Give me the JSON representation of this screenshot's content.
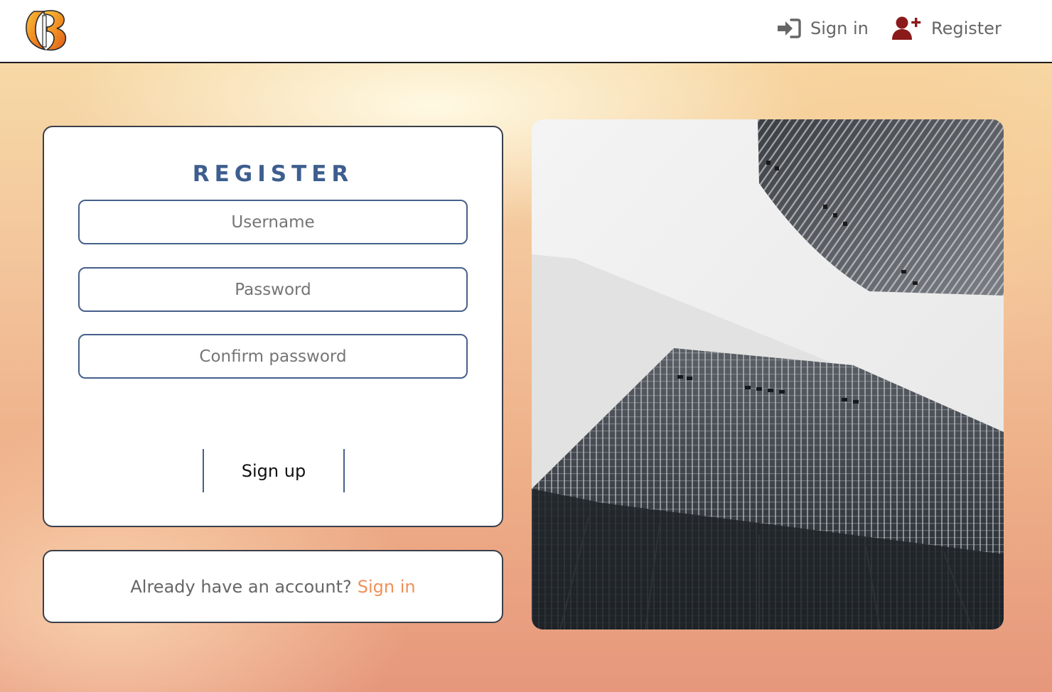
{
  "header": {
    "logo_icon": "b-logo-icon",
    "nav": {
      "signin_label": "Sign in",
      "signin_icon": "sign-in-icon",
      "register_label": "Register",
      "register_icon": "user-plus-icon"
    }
  },
  "register_form": {
    "title": "REGISTER",
    "username_placeholder": "Username",
    "password_placeholder": "Password",
    "confirm_placeholder": "Confirm password",
    "submit_label": "Sign up"
  },
  "signin_prompt": {
    "text": "Already have an account?",
    "link_label": "Sign in"
  },
  "photo": {
    "subject": "skyscrapers-photo"
  },
  "colors": {
    "accent": "#3d5e8e",
    "link": "#f0905a",
    "register_icon": "#8b1a1a",
    "signin_icon": "#666666"
  }
}
